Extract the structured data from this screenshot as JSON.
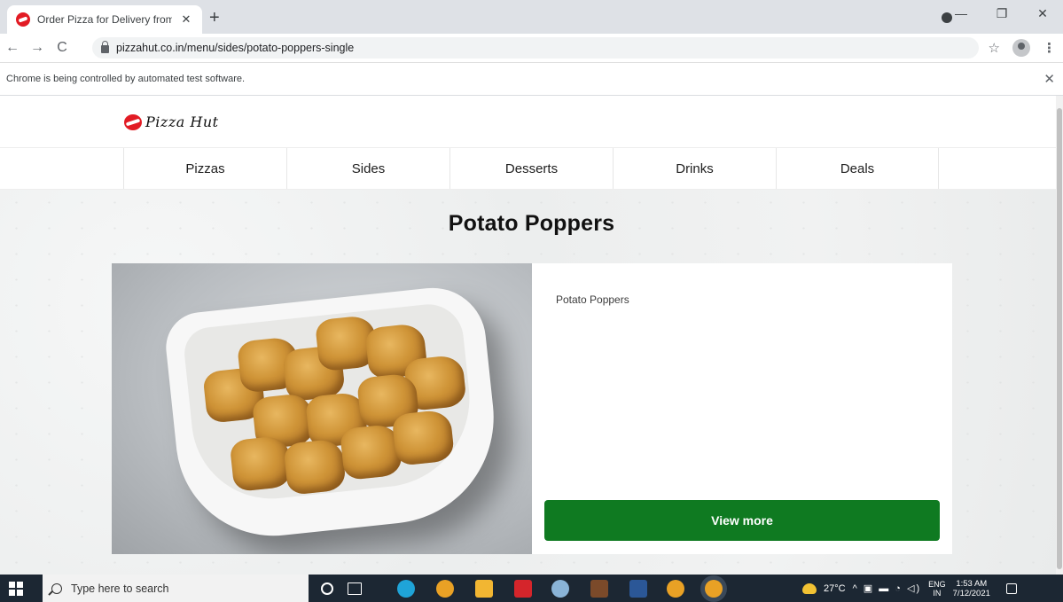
{
  "browser": {
    "tab_title": "Order Pizza for Delivery from Piz",
    "tab_close": "✕",
    "new_tab": "+",
    "url": "pizzahut.co.in/menu/sides/potato-poppers-single",
    "infobar_text": "Chrome is being controlled by automated test software.",
    "infobar_close": "✕",
    "back": "←",
    "forward": "→",
    "reload": "C",
    "star": "☆",
    "menu": "⋮",
    "minimize": "—",
    "restore": "❐",
    "close": "✕"
  },
  "site": {
    "logo_text": "Pizza Hut",
    "nav": [
      {
        "label": "Pizzas"
      },
      {
        "label": "Sides"
      },
      {
        "label": "Desserts"
      },
      {
        "label": "Drinks"
      },
      {
        "label": "Deals"
      }
    ]
  },
  "product": {
    "title": "Potato Poppers",
    "description": "Potato Poppers",
    "cta_label": "View more"
  },
  "taskbar": {
    "search_placeholder": "Type here to search",
    "temperature": "27°C",
    "lang_line1": "ENG",
    "lang_line2": "IN",
    "time": "1:53 AM",
    "date": "7/12/2021"
  },
  "colors": {
    "brand_red": "#e21b24",
    "cta_green": "#0f7a21",
    "taskbar": "#1c2733"
  }
}
